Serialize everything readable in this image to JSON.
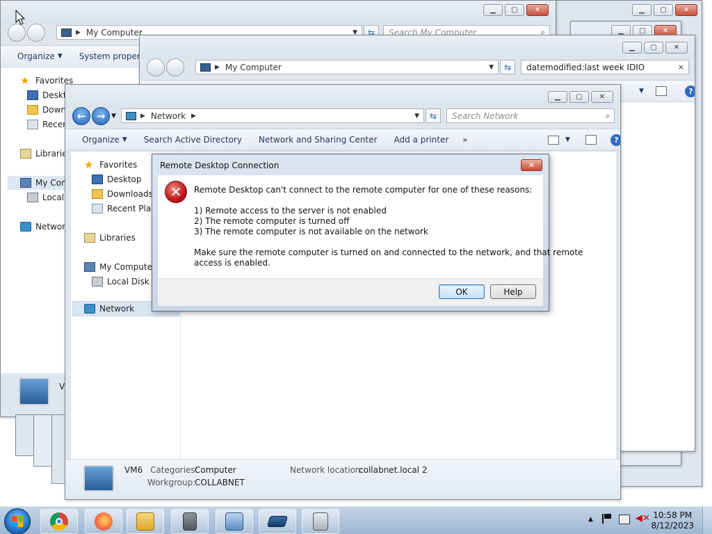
{
  "windows": {
    "back_window_2": {
      "address": "My Computer",
      "search_placeholder": "Search My Computer",
      "toolbar": {
        "organize": "Organize",
        "system_properties": "System properti"
      },
      "nav": {
        "favorites": "Favorites",
        "desktop": "Deskto",
        "downloads": "Downl",
        "recent": "Recent",
        "libraries": "Libraries",
        "my_computer": "My Com",
        "local_disk": "Local D",
        "network": "Network"
      },
      "footer_initial": "V"
    },
    "back_window_1": {
      "address": "My Computer",
      "search_value": "datemodified:last week IDIO"
    },
    "network_window": {
      "address": "Network",
      "search_placeholder": "Search Network",
      "toolbar": {
        "organize": "Organize",
        "search_ad": "Search Active Directory",
        "network_sharing": "Network and Sharing Center",
        "add_printer": "Add a printer",
        "more": "»"
      },
      "nav": {
        "favorites": "Favorites",
        "desktop": "Desktop",
        "downloads": "Downloads",
        "recent_places": "Recent Place",
        "libraries": "Libraries",
        "my_computer": "My Computer",
        "local_disk": "Local Disk (C",
        "network": "Network"
      },
      "details": {
        "name": "VM6",
        "categories_label": "Categories:",
        "categories_value": "Computer",
        "workgroup_label": "Workgroup:",
        "workgroup_value": "COLLABNET",
        "location_label": "Network location:",
        "location_value": "collabnet.local  2"
      }
    }
  },
  "dialog": {
    "title": "Remote Desktop Connection",
    "close_glyph": "✕",
    "message": "Remote Desktop can't connect to the remote computer for one of these reasons:",
    "reasons": [
      "1) Remote access to the server is not enabled",
      "2) The remote computer is turned off",
      "3) The remote computer is not available on the network"
    ],
    "advice_line1": "Make sure the remote computer is turned on and connected to the network, and that remote",
    "advice_line2": "access is enabled.",
    "ok_label": "OK",
    "help_label": "Help"
  },
  "taskbar": {
    "apps": [
      "chrome-icon",
      "firefox-icon",
      "explorer-icon",
      "server-manager-icon",
      "remote-desktop-icon",
      "powershell-icon",
      "media-icon"
    ],
    "time": "10:58 PM",
    "date": "8/12/2023"
  },
  "colors": {
    "accent": "#2f6cc0",
    "error": "#c0171b",
    "taskbar": "#9fb7d2"
  }
}
